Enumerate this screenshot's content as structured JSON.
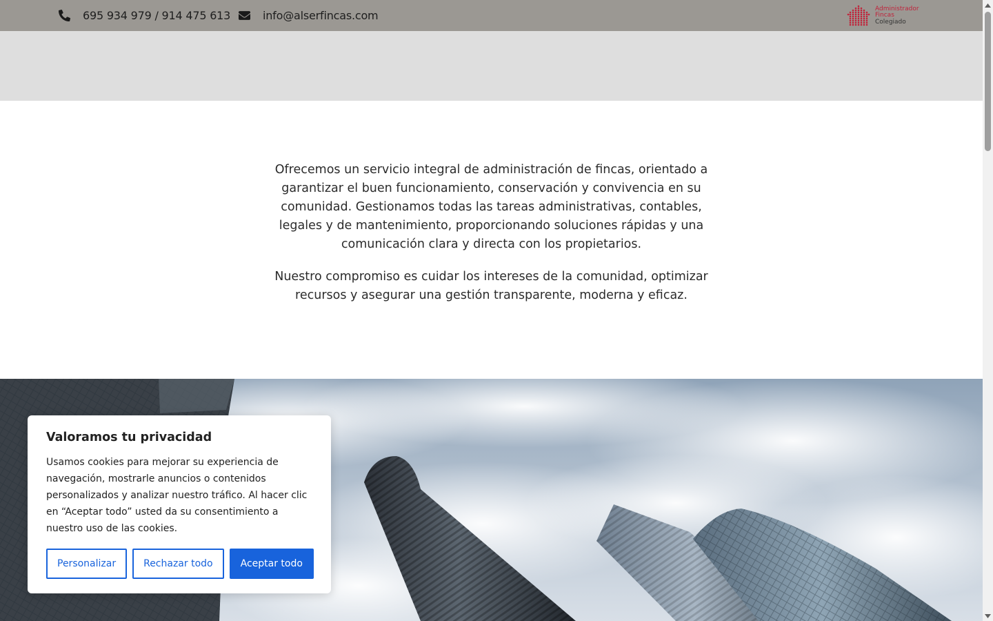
{
  "topbar": {
    "phone": "695 934 979 / 914 475 613",
    "email": "info@alserfincas.com",
    "badge": {
      "line1": "Administrador",
      "line2": "Fincas",
      "line3": "Colegiado"
    }
  },
  "intro": {
    "paragraph1": "Ofrecemos un servicio integral de administración de fincas, orientado a garantizar el buen funcionamiento, conservación y convivencia en su comunidad. Gestionamos todas las tareas administrativas, contables, legales y de mantenimiento, proporcionando soluciones rápidas y una comunicación clara y directa con los propietarios.",
    "paragraph2": "Nuestro compromiso es cuidar los intereses de la comunidad, optimizar recursos y asegurar una gestión transparente, moderna y eficaz."
  },
  "cookie": {
    "title": "Valoramos tu privacidad",
    "message": "Usamos cookies para mejorar su experiencia de navegación, mostrarle anuncios o contenidos personalizados y analizar nuestro tráfico. Al hacer clic en “Aceptar todo” usted da su consentimiento a nuestro uso de las cookies.",
    "customize_label": "Personalizar",
    "reject_label": "Rechazar todo",
    "accept_label": "Aceptar todo"
  },
  "colors": {
    "topbar_bg": "#9b9893",
    "band_bg": "#dedede",
    "accent": "#1863dc",
    "badge_red": "#c0233b"
  },
  "icons": {
    "phone": "phone-icon",
    "email": "envelope-icon",
    "badge": "dot-grid-logo-icon"
  }
}
